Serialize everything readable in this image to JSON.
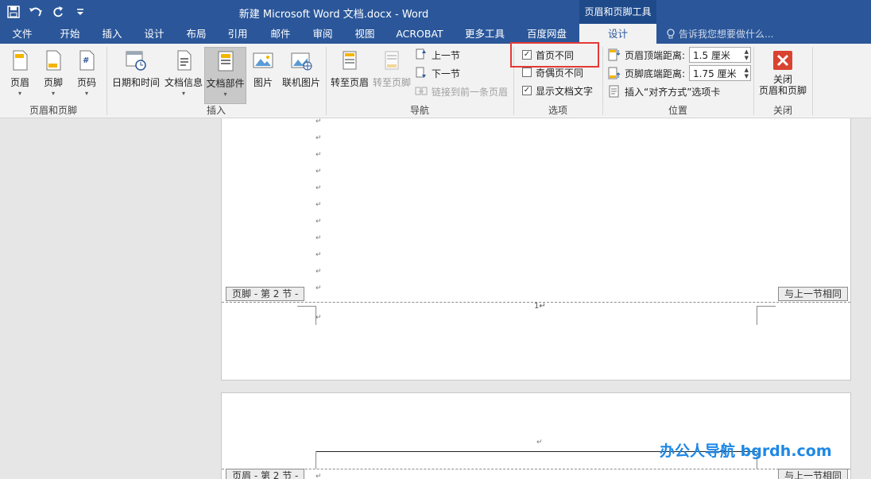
{
  "titlebar": {
    "title": "新建 Microsoft Word 文档.docx - Word",
    "context_tool": "页眉和页脚工具"
  },
  "tabs": [
    "文件",
    "开始",
    "插入",
    "设计",
    "布局",
    "引用",
    "邮件",
    "审阅",
    "视图",
    "ACROBAT",
    "更多工具",
    "百度网盘",
    "设计"
  ],
  "active_tab": 12,
  "tell_me_placeholder": "告诉我您想要做什么...",
  "ribbon": {
    "hf_group": {
      "label": "页眉和页脚",
      "header": "页眉",
      "footer": "页脚",
      "page_number": "页码"
    },
    "insert_group": {
      "label": "插入",
      "date_time": "日期和时间",
      "doc_info": "文档信息",
      "doc_parts": "文档部件",
      "picture": "图片",
      "online_picture": "联机图片"
    },
    "nav_group": {
      "label": "导航",
      "goto_header": "转至页眉",
      "goto_footer": "转至页脚",
      "prev_section": "上一节",
      "next_section": "下一节",
      "link_prev": "链接到前一条页眉"
    },
    "options_group": {
      "label": "选项",
      "diff_first": "首页不同",
      "diff_first_checked": true,
      "diff_odd_even": "奇偶页不同",
      "diff_odd_even_checked": false,
      "show_doc_text": "显示文档文字",
      "show_doc_text_checked": true
    },
    "position_group": {
      "label": "位置",
      "header_top_label": "页眉顶端距离:",
      "header_top_value": "1.5 厘米",
      "footer_bottom_label": "页脚底端距离:",
      "footer_bottom_value": "1.75 厘米",
      "align_tab": "插入“对齐方式”选项卡"
    },
    "close_group": {
      "label": "关闭",
      "close_line1": "关闭",
      "close_line2": "页眉和页脚"
    }
  },
  "document": {
    "para_mark": "↵",
    "footer_tag": "页脚 - 第 2 节 -",
    "header_tag": "页眉 - 第 2 节 -",
    "same_as_prev": "与上一节相同",
    "page_number_text": "1↵"
  },
  "watermark": "办公人导航  bgrdh.com"
}
